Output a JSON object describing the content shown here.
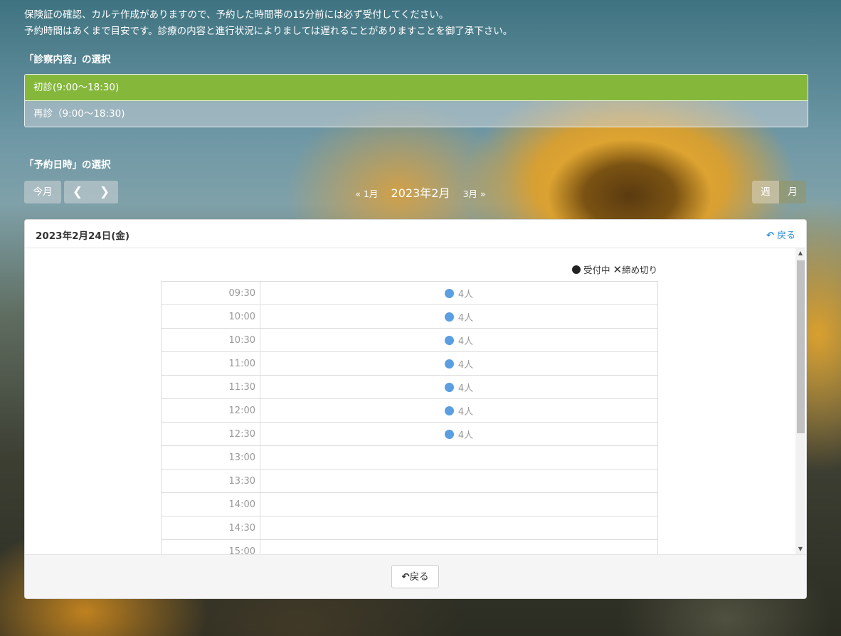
{
  "notice": {
    "line1": "保険証の確認、カルテ作成がありますので、予約した時間帯の15分前には必ず受付してください。",
    "line2": "予約時間はあくまで目安です。診療の内容と進行状況によりましては遅れることがありますことを御了承下さい。"
  },
  "service_section": {
    "title": "「診察内容」の選択",
    "items": [
      {
        "label": "初診(9:00～18:30)",
        "selected": true
      },
      {
        "label": "再診（9:00～18:30)",
        "selected": false
      }
    ]
  },
  "date_section": {
    "title": "「予約日時」の選択",
    "today_button": "今月",
    "prev_month": "1月",
    "current_month": "2023年2月",
    "next_month": "3月",
    "view_week": "週",
    "view_month": "月"
  },
  "panel": {
    "date_label": "2023年2月24日(金)",
    "back_link": "戻る",
    "legend": {
      "open": "受付中",
      "closed": "締め切り"
    },
    "slots": [
      {
        "time": "09:30",
        "availability": "4人"
      },
      {
        "time": "10:00",
        "availability": "4人"
      },
      {
        "time": "10:30",
        "availability": "4人"
      },
      {
        "time": "11:00",
        "availability": "4人"
      },
      {
        "time": "11:30",
        "availability": "4人"
      },
      {
        "time": "12:00",
        "availability": "4人"
      },
      {
        "time": "12:30",
        "availability": "4人"
      },
      {
        "time": "13:00",
        "availability": ""
      },
      {
        "time": "13:30",
        "availability": ""
      },
      {
        "time": "14:00",
        "availability": ""
      },
      {
        "time": "14:30",
        "availability": ""
      },
      {
        "time": "15:00",
        "availability": ""
      }
    ],
    "footer_back_button": "戻る"
  },
  "colors": {
    "selected_service": "#84b73a",
    "slot_dot": "#5b9fe1",
    "link": "#2a8fd6"
  }
}
